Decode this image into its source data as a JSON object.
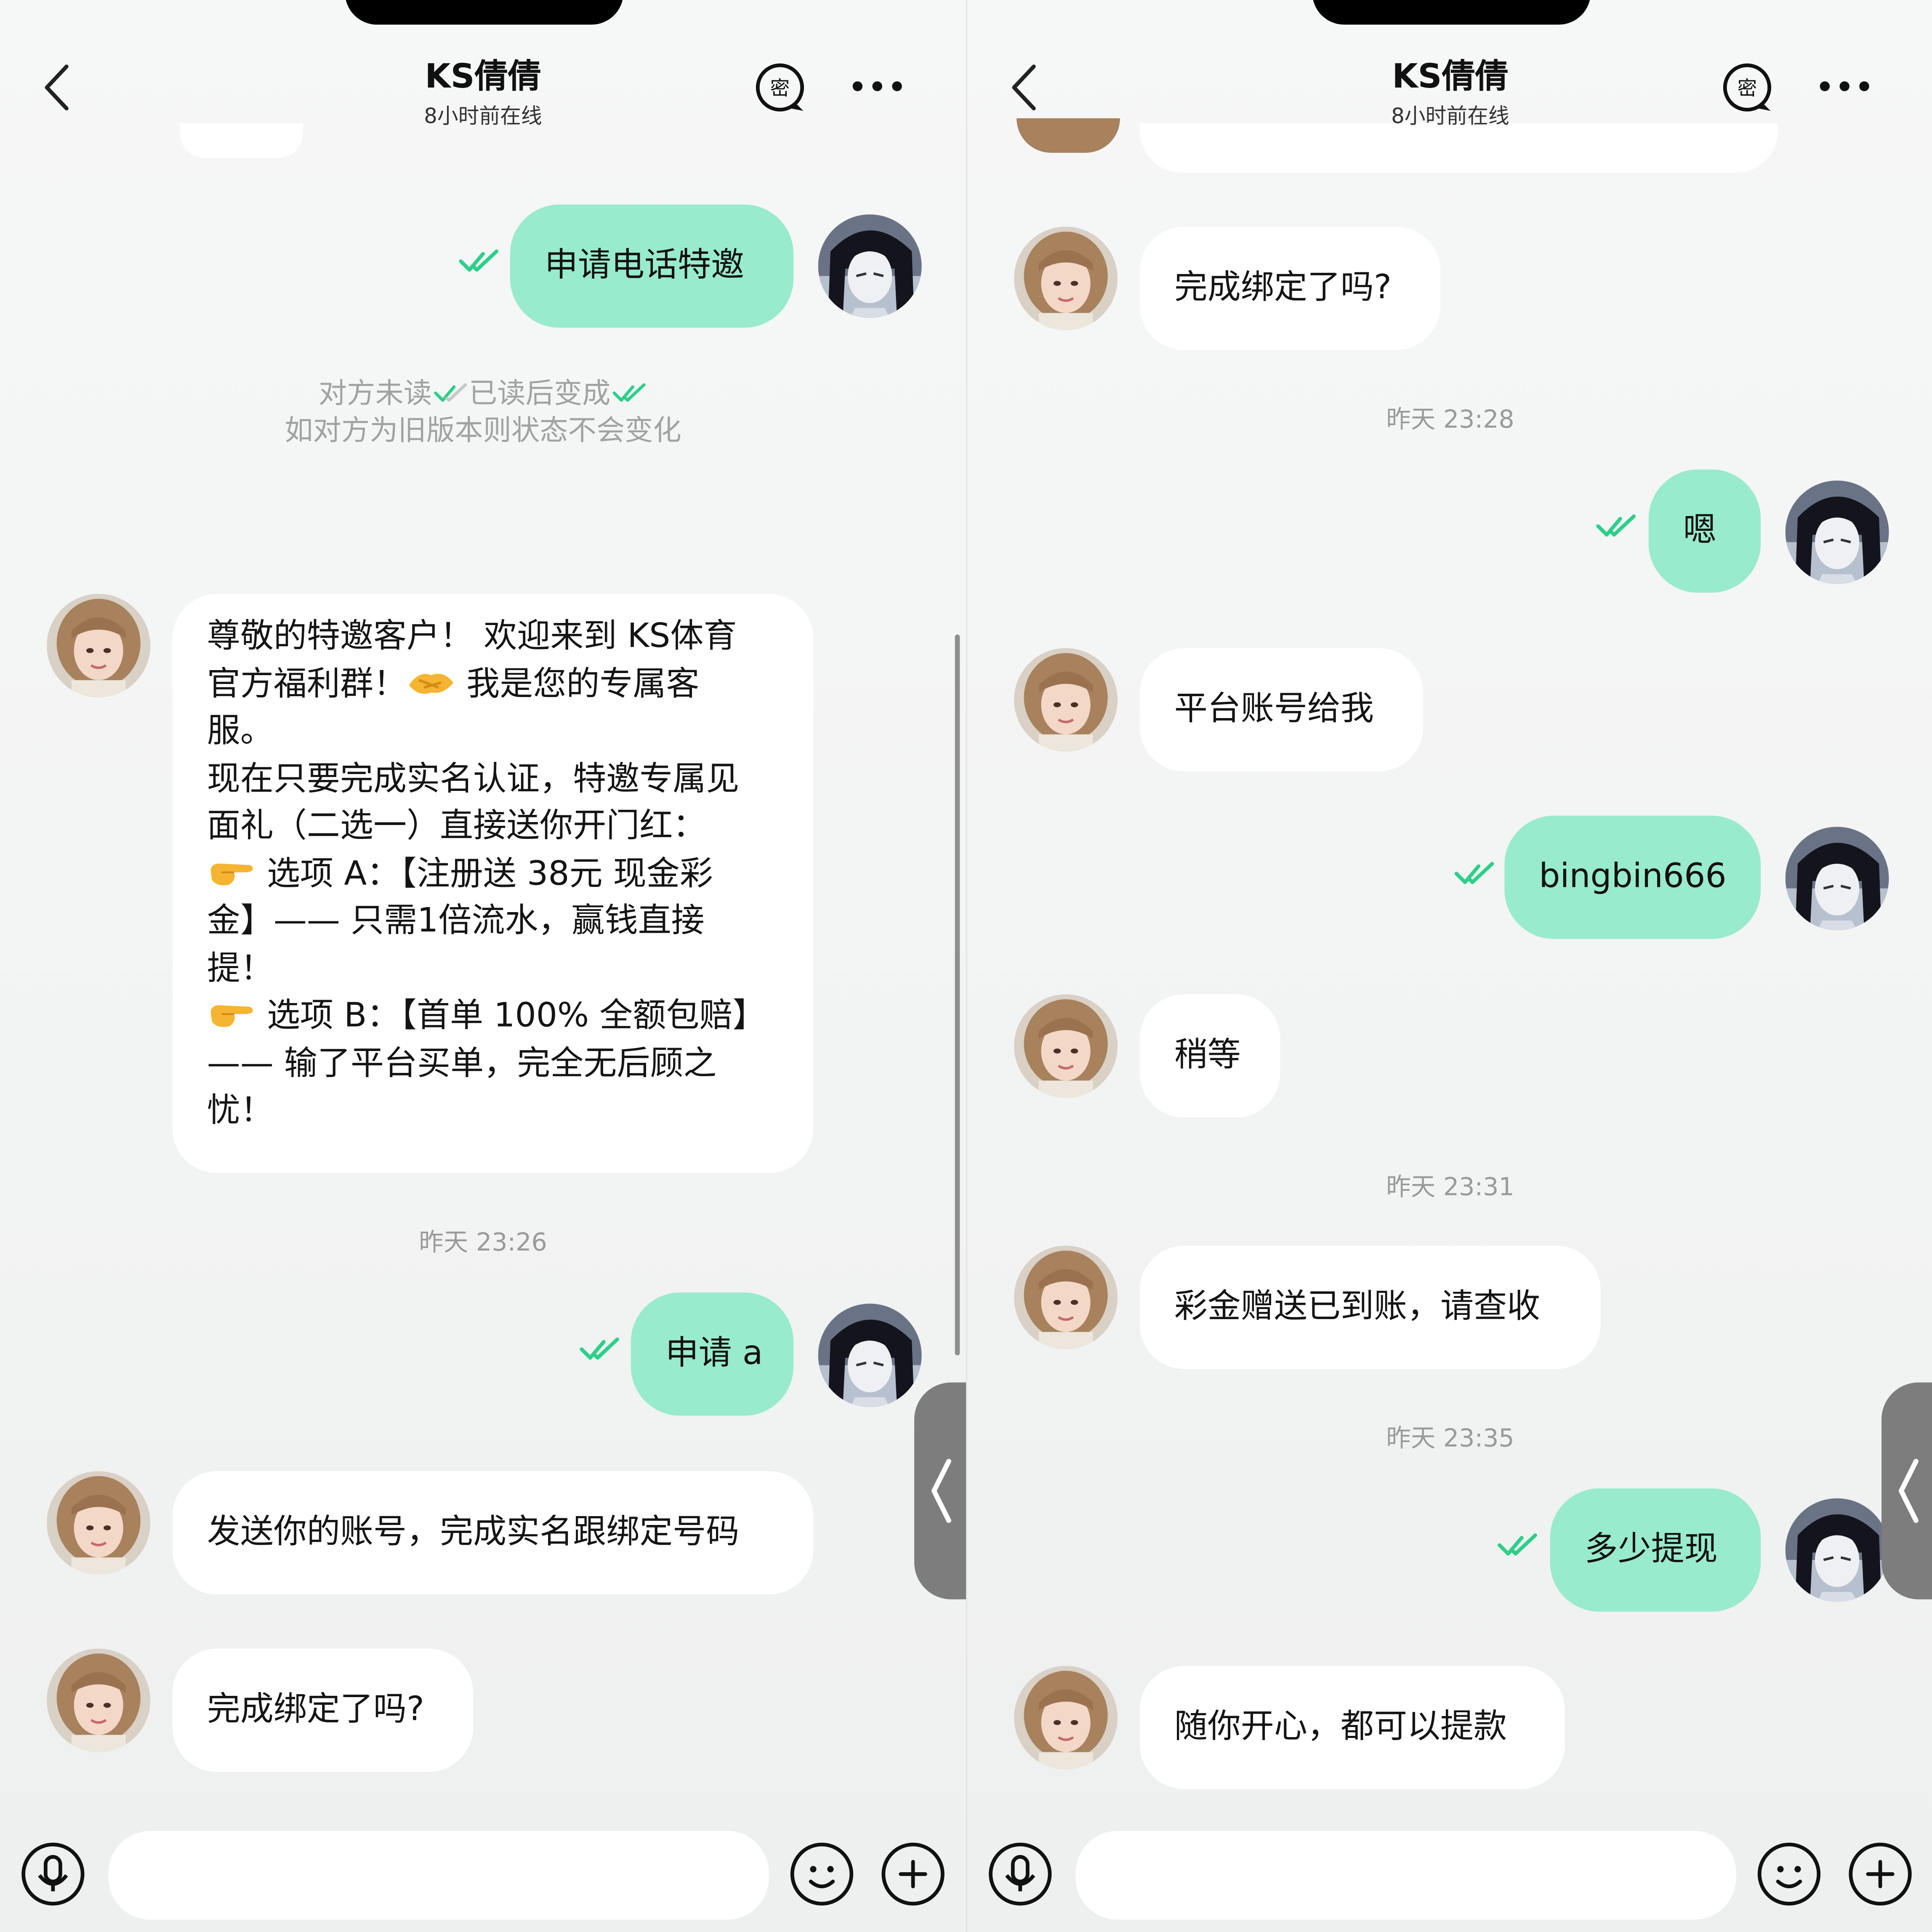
{
  "colors": {
    "out_bubble": "#98ebcd",
    "check_green": "#2ecf8a",
    "timestamp": "#9a9a9a"
  },
  "left": {
    "header": {
      "title": "KS倩倩",
      "status": "8小时前在线"
    },
    "hint": {
      "line1a": "对方未读",
      "line1b": "已读后变成",
      "line2": "如对方为旧版本则状态不会变化"
    },
    "msg_out_1": "申请电话特邀",
    "welcome": {
      "l1": "尊敬的特邀客户！ 欢迎来到 KS体育",
      "l2a": "官方福利群！",
      "l2b": " 我是您的专属客",
      "l3": "服。",
      "l4": "现在只要完成实名认证，特邀专属见",
      "l5": "面礼（二选一）直接送你开门红：",
      "l6": " 选项 A：【注册送 38元 现金彩",
      "l7": "金】—— 只需1倍流水，赢钱直接",
      "l8": "提！",
      "l9": " 选项 B：【首单 100% 全额包赔】",
      "l10": "—— 输了平台买单，完全无后顾之",
      "l11": "忧！"
    },
    "time_1": "昨天 23:26",
    "msg_out_2": "申请 a",
    "msg_in_2": "发送你的账号，完成实名跟绑定号码",
    "msg_in_3": "完成绑定了吗?"
  },
  "right": {
    "header": {
      "title": "KS倩倩",
      "status": "8小时前在线"
    },
    "msg_in_1": "完成绑定了吗?",
    "time_1": "昨天 23:28",
    "msg_out_1": "嗯",
    "msg_in_2": "平台账号给我",
    "msg_out_2": "bingbin666",
    "msg_in_3": "稍等",
    "time_2": "昨天 23:31",
    "msg_in_4": "彩金赠送已到账，请查收",
    "time_3": "昨天 23:35",
    "msg_out_3": "多少提现",
    "msg_in_5": "随你开心，都可以提款"
  },
  "icons": {
    "back": "chevron-left-icon",
    "encrypt": "mi-lock-icon",
    "more": "more-dots-icon",
    "mic": "microphone-icon",
    "emoji": "smile-icon",
    "plus": "plus-icon",
    "handshake": "handshake-emoji",
    "pointer": "pointing-right-emoji"
  }
}
